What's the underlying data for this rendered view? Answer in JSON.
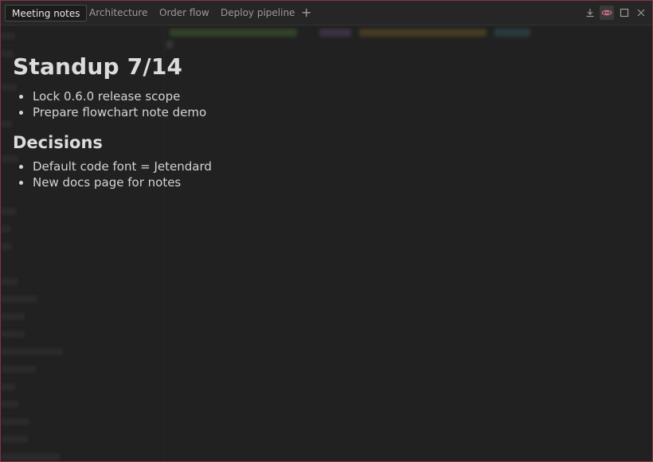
{
  "tabs": [
    {
      "label": "Meeting notes",
      "active": true
    },
    {
      "label": "Architecture",
      "active": false
    },
    {
      "label": "Order flow",
      "active": false
    },
    {
      "label": "Deploy pipeline",
      "active": false
    }
  ],
  "tab_add_label": "+",
  "icons": {
    "download": "download-icon",
    "preview": "eye-icon",
    "maximize": "maximize-icon",
    "close": "close-icon"
  },
  "colors": {
    "border_accent": "#8a3440",
    "preview_active": "#d9728a"
  },
  "note": {
    "title": "Standup 7/14",
    "list1": [
      "Lock 0.6.0 release scope",
      "Prepare flowchart note demo"
    ],
    "heading2": "Decisions",
    "list2": [
      "Default code font = Jetendard",
      "New docs page for notes"
    ]
  }
}
